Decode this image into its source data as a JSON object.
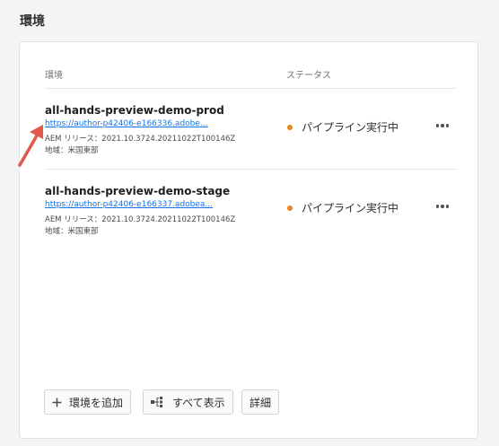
{
  "section_title": "環境",
  "table": {
    "col_environment": "環境",
    "col_status": "ステータス"
  },
  "environments": [
    {
      "name": "all-hands-preview-demo-prod",
      "link": "https://author-p42406-e166336.adobe...",
      "release": "AEM リリース：2021.10.3724.20211022T100146Z",
      "region": "地域：米国東部",
      "status": "パイプライン実行中",
      "status_color": "#e68619"
    },
    {
      "name": "all-hands-preview-demo-stage",
      "link": "https://author-p42406-e166337.adobea...",
      "release": "AEM リリース：2021.10.3724.20211022T100146Z",
      "region": "地域：米国東部",
      "status": "パイプライン実行中",
      "status_color": "#e68619"
    }
  ],
  "actions": {
    "add_label": "環境を追加",
    "add_icon": "plus-icon",
    "show_all_label": "すべて表示",
    "show_all_icon": "hierarchy-icon",
    "details_label": "詳細"
  },
  "annotation_arrow_color": "#e0584a"
}
